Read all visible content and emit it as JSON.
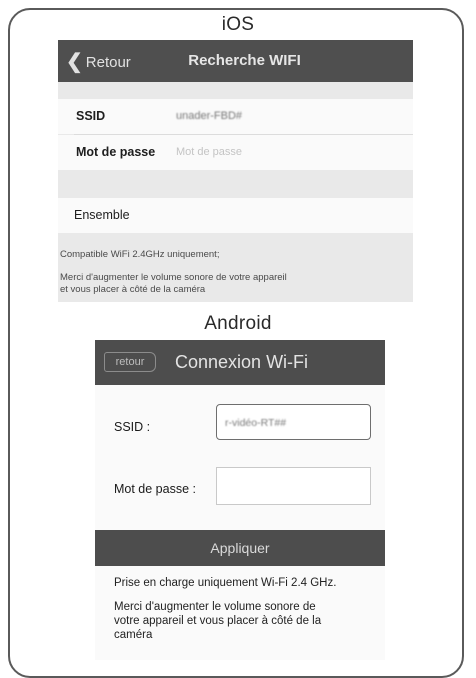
{
  "ios": {
    "label": "iOS",
    "nav": {
      "back_label": "Retour",
      "title": "Recherche WIFI"
    },
    "ssid": {
      "label": "SSID",
      "value": "unader-FBD#"
    },
    "password": {
      "label": "Mot de passe",
      "placeholder": "Mot de passe"
    },
    "submit_label": "Ensemble",
    "note_compat": "Compatible WiFi 2.4GHz uniquement;",
    "note_volume_line1": "Merci d'augmenter le volume sonore de votre appareil",
    "note_volume_line2": "et vous placer à côté de la caméra"
  },
  "android": {
    "label": "Android",
    "bar": {
      "back_label": "retour",
      "title": "Connexion Wi-Fi"
    },
    "ssid": {
      "label": "SSID :",
      "value": "r-vidéo-RT##"
    },
    "password": {
      "label": "Mot de passe :",
      "value": ""
    },
    "apply_label": "Appliquer",
    "note_support": "Prise en charge uniquement Wi-Fi 2.4 GHz.",
    "note_volume_line1": "Merci d'augmenter le volume sonore de",
    "note_volume_line2": "votre appareil et vous placer à côté de la",
    "note_volume_line3": "caméra"
  },
  "colors": {
    "bar": "#4d4d4d",
    "panel": "#e9e9e9",
    "frame": "#5a5a5a"
  }
}
